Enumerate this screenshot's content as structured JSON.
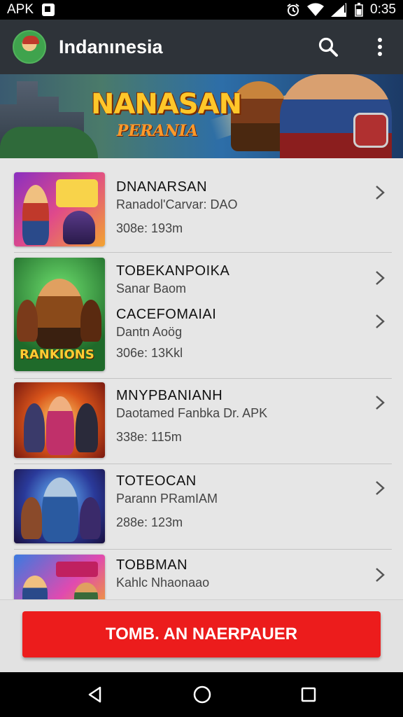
{
  "status_bar": {
    "app_label": "APK",
    "time": "0:35"
  },
  "app_bar": {
    "title": "Indanınesia",
    "logo": "game-logo",
    "actions": [
      "search-icon",
      "more-vert-icon"
    ]
  },
  "banner": {
    "title": "NANASAN",
    "subtitle": "PERANIA"
  },
  "games": [
    {
      "title": "DNANARSAN",
      "subtitle": "Ranadol'Carvar: DAO",
      "meta": "308e: 193m",
      "thumb_label": ""
    },
    {
      "title": "TOBEKANPOIKA",
      "subtitle": "Sanar Baom",
      "meta": "",
      "thumb_label": "RANKIONS"
    },
    {
      "title": "CACEFOMAIAI",
      "subtitle": "Dantn Aoög",
      "meta": "306e: 13Kkl",
      "thumb_label": ""
    },
    {
      "title": "MNYPBANIANH",
      "subtitle": "Daotamed Fanbka Dr. APK",
      "meta": "338e: 115m",
      "thumb_label": ""
    },
    {
      "title": "TOTEOCAN",
      "subtitle": "Parann PRamIAM",
      "meta": "288e: 123m",
      "thumb_label": ""
    },
    {
      "title": "TOBBMAN",
      "subtitle": "Kahlc Nhaonaao",
      "meta": "",
      "thumb_label": ""
    }
  ],
  "cta": {
    "label": "TOMB. AN NAERPAUER"
  },
  "nav": [
    "back-icon",
    "home-icon",
    "recents-icon"
  ],
  "colors": {
    "app_bar": "#2e3339",
    "cta": "#ec1c1c",
    "background": "#e6e6e6"
  }
}
